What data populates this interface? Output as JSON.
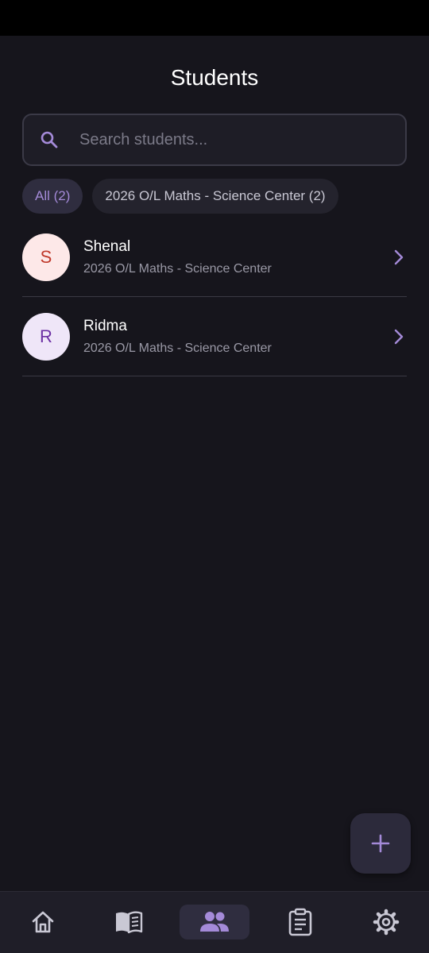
{
  "header": {
    "title": "Students"
  },
  "search": {
    "placeholder": "Search students...",
    "value": ""
  },
  "filters": [
    {
      "label": "All (2)",
      "active": true
    },
    {
      "label": "2026 O/L Maths - Science Center (2)",
      "active": false
    }
  ],
  "students": [
    {
      "initial": "S",
      "name": "Shenal",
      "class": "2026 O/L Maths - Science Center",
      "avatar_bg": "#fde8e8",
      "avatar_fg": "#c0392b"
    },
    {
      "initial": "R",
      "name": "Ridma",
      "class": "2026 O/L Maths - Science Center",
      "avatar_bg": "#efe6f8",
      "avatar_fg": "#6b2fa3"
    }
  ],
  "nav": {
    "items": [
      {
        "icon": "home-icon",
        "active": false
      },
      {
        "icon": "book-icon",
        "active": false
      },
      {
        "icon": "people-icon",
        "active": true
      },
      {
        "icon": "clipboard-icon",
        "active": false
      },
      {
        "icon": "gear-icon",
        "active": false
      }
    ]
  },
  "fab": {
    "icon": "plus-icon"
  },
  "colors": {
    "accent": "#a48ad8",
    "background": "#16151c",
    "icon_inactive": "#c9c8d4"
  }
}
